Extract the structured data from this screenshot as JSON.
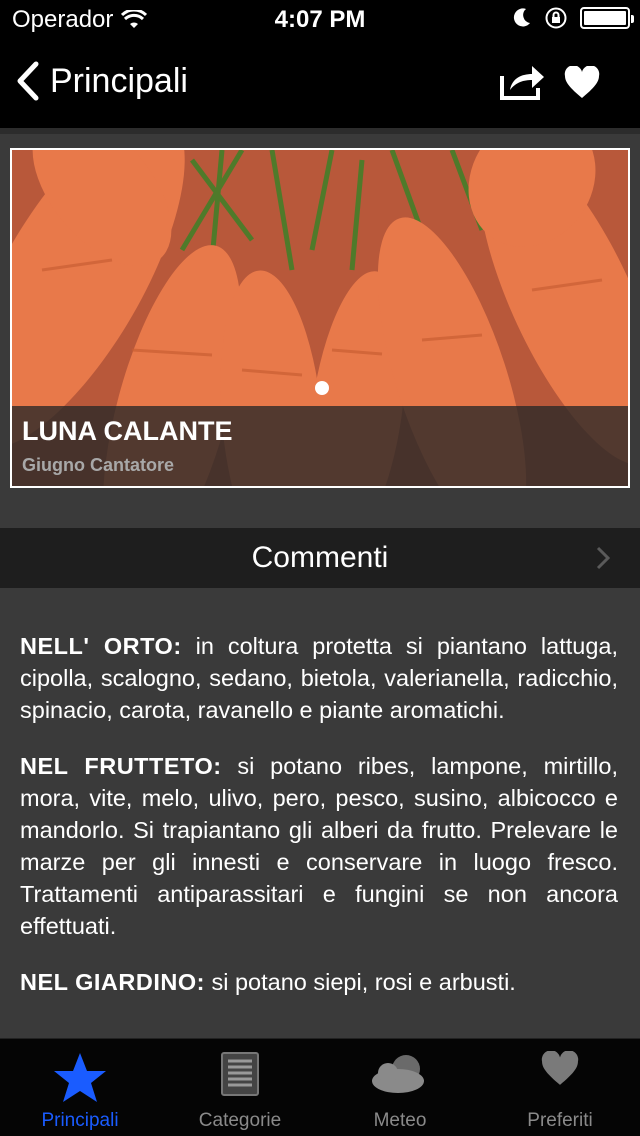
{
  "statusbar": {
    "carrier": "Operador",
    "time": "4:07 PM",
    "battery_level": 1.0
  },
  "navbar": {
    "back_label": "Principali",
    "back_icon": "chevron-left-icon",
    "share_icon": "share-icon",
    "favorite_icon": "heart-icon"
  },
  "hero": {
    "title": "LUNA CALANTE",
    "subtitle": "Giugno Cantatore",
    "page_index": 1,
    "page_count": 1
  },
  "comments": {
    "label": "Commenti"
  },
  "article": {
    "paragraphs": [
      {
        "heading": "NELL' ORTO:",
        "text": " in coltura protetta si piantano lattuga, cipolla, scalogno, sedano, bietola, valerianella, radicchio, spinacio, carota, ravanello e piante aromatichi."
      },
      {
        "heading": "NEL FRUTTETO:",
        "text": " si potano ribes, lampone, mirtillo, mora, vite, melo, ulivo, pero, pesco, susino, albicocco e mandorlo. Si trapiantano gli alberi da frutto. Prelevare le marze per gli innesti e conservare in luogo fresco. Trattamenti antiparassitari e fungini se non ancora effettuati."
      },
      {
        "heading": "NEL GIARDINO:",
        "text": " si potano siepi, rosi e arbusti."
      }
    ]
  },
  "tabbar": {
    "tabs": [
      {
        "label": "Principali",
        "icon": "star-icon",
        "active": true
      },
      {
        "label": "Categorie",
        "icon": "list-icon",
        "active": false
      },
      {
        "label": "Meteo",
        "icon": "weather-icon",
        "active": false
      },
      {
        "label": "Preferiti",
        "icon": "heart-icon",
        "active": false
      }
    ]
  },
  "colors": {
    "accent": "#1a5cff",
    "background": "#3a3a3a",
    "bar": "#000000"
  }
}
